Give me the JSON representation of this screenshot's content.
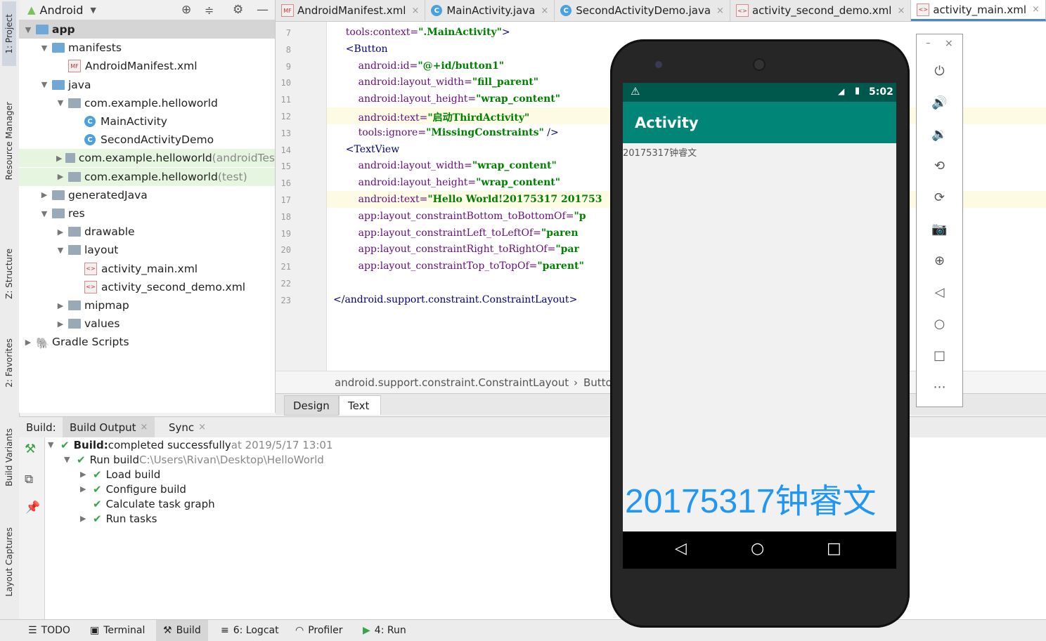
{
  "left_strip": {
    "project_tab": "1: Project",
    "resource_manager_tab": "Resource Manager",
    "structure_tab": "Z: Structure",
    "favorites_tab": "2: Favorites",
    "build_variants_tab": "Build Variants",
    "layout_captures_tab": "Layout Captures"
  },
  "project": {
    "view_selector": "Android",
    "tree": [
      {
        "label": "app",
        "extra": "",
        "depth": 0,
        "kind": "module",
        "arrow": "▼",
        "style": "sel"
      },
      {
        "label": "manifests",
        "extra": "",
        "depth": 1,
        "kind": "folder-blue",
        "arrow": "▼",
        "style": ""
      },
      {
        "label": "AndroidManifest.xml",
        "extra": "",
        "depth": 2,
        "kind": "manifest",
        "arrow": "",
        "style": ""
      },
      {
        "label": "java",
        "extra": "",
        "depth": 1,
        "kind": "folder-blue",
        "arrow": "▼",
        "style": ""
      },
      {
        "label": "com.example.helloworld",
        "extra": "",
        "depth": 2,
        "kind": "folder",
        "arrow": "▼",
        "style": ""
      },
      {
        "label": "MainActivity",
        "extra": "",
        "depth": 3,
        "kind": "class",
        "arrow": "",
        "style": ""
      },
      {
        "label": "SecondActivityDemo",
        "extra": "",
        "depth": 3,
        "kind": "class",
        "arrow": "",
        "style": ""
      },
      {
        "label": "com.example.helloworld",
        "extra": " (androidTes",
        "depth": 2,
        "kind": "folder",
        "arrow": "▶",
        "style": "green"
      },
      {
        "label": "com.example.helloworld",
        "extra": " (test)",
        "depth": 2,
        "kind": "folder",
        "arrow": "▶",
        "style": "green"
      },
      {
        "label": "generatedJava",
        "extra": "",
        "depth": 1,
        "kind": "folder",
        "arrow": "▶",
        "style": ""
      },
      {
        "label": "res",
        "extra": "",
        "depth": 1,
        "kind": "folder",
        "arrow": "▼",
        "style": ""
      },
      {
        "label": "drawable",
        "extra": "",
        "depth": 2,
        "kind": "folder",
        "arrow": "▶",
        "style": ""
      },
      {
        "label": "layout",
        "extra": "",
        "depth": 2,
        "kind": "folder",
        "arrow": "▼",
        "style": ""
      },
      {
        "label": "activity_main.xml",
        "extra": "",
        "depth": 3,
        "kind": "xml",
        "arrow": "",
        "style": ""
      },
      {
        "label": "activity_second_demo.xml",
        "extra": "",
        "depth": 3,
        "kind": "xml",
        "arrow": "",
        "style": ""
      },
      {
        "label": "mipmap",
        "extra": "",
        "depth": 2,
        "kind": "folder",
        "arrow": "▶",
        "style": ""
      },
      {
        "label": "values",
        "extra": "",
        "depth": 2,
        "kind": "folder",
        "arrow": "▶",
        "style": ""
      },
      {
        "label": "Gradle Scripts",
        "extra": "",
        "depth": 0,
        "kind": "gradle",
        "arrow": "▶",
        "style": ""
      }
    ]
  },
  "editor_tabs": [
    {
      "label": "AndroidManifest.xml",
      "icon": "manifest-icon",
      "active": false
    },
    {
      "label": "MainActivity.java",
      "icon": "class-icon",
      "active": false
    },
    {
      "label": "SecondActivityDemo.java",
      "icon": "class-icon",
      "active": false
    },
    {
      "label": "activity_second_demo.xml",
      "icon": "layout-xml-icon",
      "active": false
    },
    {
      "label": "activity_main.xml",
      "icon": "layout-xml-icon",
      "active": true
    }
  ],
  "code_lines": [
    {
      "n": "7",
      "parts": [
        [
          "attr",
          "    tools:context="
        ],
        [
          "val",
          "\".MainActivity\""
        ],
        [
          "tag",
          ">"
        ]
      ]
    },
    {
      "n": "8",
      "parts": [
        [
          "tag",
          "    <Button"
        ]
      ]
    },
    {
      "n": "9",
      "parts": [
        [
          "attr",
          "        android:id="
        ],
        [
          "val",
          "\"@+id/button1\""
        ]
      ]
    },
    {
      "n": "10",
      "parts": [
        [
          "attr",
          "        android:layout_width="
        ],
        [
          "val",
          "\"fill_parent\""
        ]
      ]
    },
    {
      "n": "11",
      "parts": [
        [
          "attr",
          "        android:layout_height="
        ],
        [
          "val",
          "\"wrap_content\""
        ]
      ]
    },
    {
      "n": "12",
      "parts": [
        [
          "attr",
          "        android:text="
        ],
        [
          "val",
          "\"启动ThirdActivity\""
        ]
      ]
    },
    {
      "n": "13",
      "parts": [
        [
          "attr",
          "        tools:ignore="
        ],
        [
          "val",
          "\"MissingConstraints\""
        ],
        [
          "tag",
          " />"
        ]
      ]
    },
    {
      "n": "14",
      "parts": [
        [
          "tag",
          "    <TextView"
        ]
      ]
    },
    {
      "n": "15",
      "parts": [
        [
          "attr",
          "        android:layout_width="
        ],
        [
          "val",
          "\"wrap_content\""
        ]
      ]
    },
    {
      "n": "16",
      "parts": [
        [
          "attr",
          "        android:layout_height="
        ],
        [
          "val",
          "\"wrap_content\""
        ]
      ]
    },
    {
      "n": "17",
      "parts": [
        [
          "attr",
          "        android:text="
        ],
        [
          "val",
          "\"Hello World!20175317 201753"
        ]
      ]
    },
    {
      "n": "18",
      "parts": [
        [
          "attr",
          "        app:layout_constraintBottom_toBottomOf="
        ],
        [
          "val",
          "\"p"
        ]
      ]
    },
    {
      "n": "19",
      "parts": [
        [
          "attr",
          "        app:layout_constraintLeft_toLeftOf="
        ],
        [
          "val",
          "\"paren"
        ]
      ]
    },
    {
      "n": "20",
      "parts": [
        [
          "attr",
          "        app:layout_constraintRight_toRightOf="
        ],
        [
          "val",
          "\"par"
        ]
      ]
    },
    {
      "n": "21",
      "parts": [
        [
          "attr",
          "        app:layout_constraintTop_toTopOf="
        ],
        [
          "val",
          "\"parent\""
        ]
      ]
    },
    {
      "n": "22",
      "parts": [
        [
          "tag",
          ""
        ]
      ]
    },
    {
      "n": "23",
      "parts": [
        [
          "tag",
          "</android.support.constraint.ConstraintLayout>"
        ]
      ]
    }
  ],
  "breadcrumb": {
    "root": "android.support.constraint.ConstraintLayout",
    "separator": "›",
    "child": "Butto"
  },
  "design_tabs": {
    "design": "Design",
    "text": "Text"
  },
  "build": {
    "label": "Build:",
    "tab_output": "Build Output",
    "tab_sync": "Sync",
    "rows": [
      {
        "bold": "Build:",
        "text": " completed successfully",
        "muted": " at 2019/5/17 13:01",
        "depth": 0,
        "arrow": "▼"
      },
      {
        "bold": "",
        "text": "Run build",
        "muted": " C:\\Users\\Rivan\\Desktop\\HelloWorld",
        "depth": 1,
        "arrow": "▼"
      },
      {
        "bold": "",
        "text": "Load build",
        "muted": "",
        "depth": 2,
        "arrow": "▶"
      },
      {
        "bold": "",
        "text": "Configure build",
        "muted": "",
        "depth": 2,
        "arrow": "▶"
      },
      {
        "bold": "",
        "text": "Calculate task graph",
        "muted": "",
        "depth": 2,
        "arrow": ""
      },
      {
        "bold": "",
        "text": "Run tasks",
        "muted": "",
        "depth": 2,
        "arrow": "▶"
      }
    ]
  },
  "bottom_bar": {
    "todo": "TODO",
    "terminal": "Terminal",
    "build": "Build",
    "logcat": "6: Logcat",
    "profiler": "Profiler",
    "run": "4: Run"
  },
  "emulator": {
    "time": "5:02",
    "app_title": "Activity",
    "small_text": "20175317钟睿文",
    "big_text": "20175317钟睿文",
    "colors": {
      "status_bar": "#00574b",
      "app_bar": "#008577",
      "big_text": "#2196f3"
    }
  }
}
